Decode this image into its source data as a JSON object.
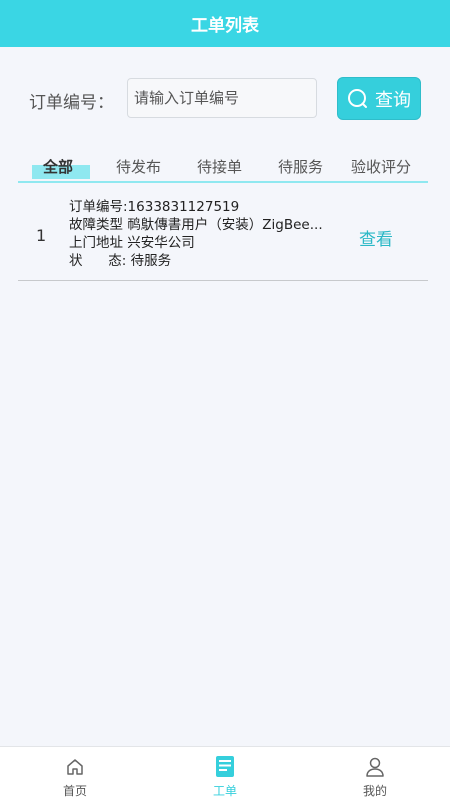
{
  "header": {
    "title": "工单列表"
  },
  "search": {
    "label": "订单编号：",
    "placeholder": "请输入订单编号",
    "button_label": "查询"
  },
  "tabs": [
    {
      "label": "全部",
      "active": true
    },
    {
      "label": "待发布"
    },
    {
      "label": "待接单"
    },
    {
      "label": "待服务"
    },
    {
      "label": "验收评分"
    }
  ],
  "orders": [
    {
      "index": "1",
      "order_no": "订单编号:1633831127519",
      "fault_type": "故障类型 䴓䲦傳書用户（安装）ZigBee...",
      "address": "上门地址 兴安华公司",
      "status": "状      态: 待服务",
      "view_label": "查看"
    }
  ],
  "nav": [
    {
      "label": "首页",
      "icon": "home-icon"
    },
    {
      "label": "工单",
      "icon": "document-icon",
      "active": true
    },
    {
      "label": "我的",
      "icon": "user-icon"
    }
  ],
  "colors": {
    "accent": "#3ad6e4",
    "accent_dark": "#2ab8c6",
    "tab_underline": "#8fe8f0"
  }
}
